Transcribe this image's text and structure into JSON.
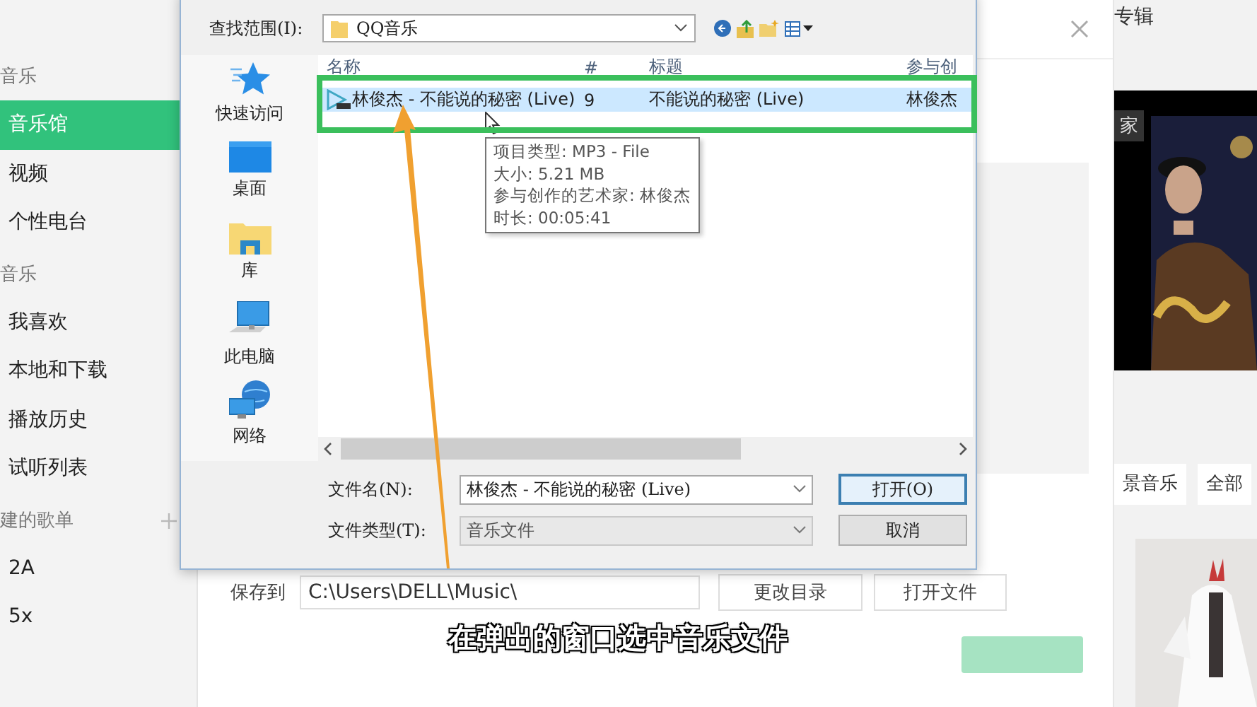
{
  "sidebar": {
    "sections": [
      {
        "heading": "音乐",
        "items": [
          {
            "label": "音乐馆",
            "selected": true
          },
          {
            "label": "视频",
            "selected": false
          },
          {
            "label": "个性电台",
            "selected": false
          }
        ]
      },
      {
        "heading": "音乐",
        "items": [
          {
            "label": "我喜欢",
            "selected": false
          },
          {
            "label": "本地和下载",
            "selected": false
          },
          {
            "label": "播放历史",
            "selected": false
          },
          {
            "label": "试听列表",
            "selected": false
          }
        ]
      },
      {
        "heading": "建的歌单",
        "items": [
          {
            "label": "2A",
            "selected": false
          },
          {
            "label": "5x",
            "selected": false
          }
        ]
      }
    ]
  },
  "download_dialog": {
    "save_to": {
      "label": "保存到",
      "value": "C:\\Users\\DELL\\Music\\"
    },
    "buttons": [
      "更改目录",
      "打开文件"
    ]
  },
  "right_panel": {
    "heading": "专辑",
    "banner_tag": "家",
    "tabs": [
      "景音乐",
      "全部"
    ]
  },
  "file_dialog": {
    "look_in_label": "查找范围(I):",
    "location": "QQ音乐",
    "places": [
      {
        "label": "快速访问",
        "kind": "quick"
      },
      {
        "label": "桌面",
        "kind": "desktop"
      },
      {
        "label": "库",
        "kind": "library"
      },
      {
        "label": "此电脑",
        "kind": "computer"
      },
      {
        "label": "网络",
        "kind": "network"
      }
    ],
    "columns": [
      "名称",
      "#",
      "标题",
      "参与创"
    ],
    "rows": [
      {
        "name": "林俊杰 - 不能说的秘密 (Live)",
        "number": "9",
        "title": "不能说的秘密 (Live)",
        "artist": "林俊杰",
        "selected": true
      }
    ],
    "tooltip": [
      "项目类型: MP3 - File",
      "大小: 5.21 MB",
      "参与创作的艺术家: 林俊杰",
      "时长: 00:05:41"
    ],
    "file_name": {
      "label": "文件名(N):",
      "value": "林俊杰 - 不能说的秘密 (Live)"
    },
    "file_type": {
      "label": "文件类型(T):",
      "value": "音乐文件"
    },
    "buttons": [
      {
        "label": "打开(O)",
        "default": true
      },
      {
        "label": "取消",
        "default": false
      }
    ]
  },
  "caption": "在弹出的窗口选中音乐文件"
}
